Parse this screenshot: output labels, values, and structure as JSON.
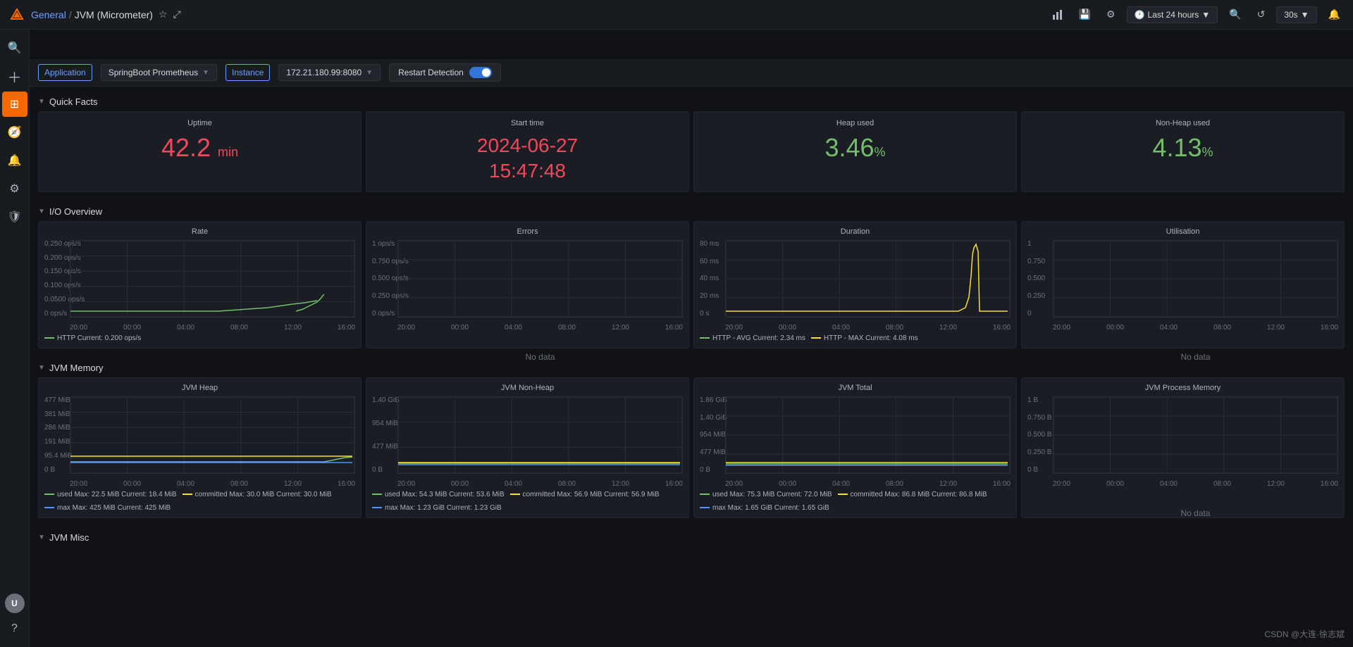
{
  "topbar": {
    "logo": "G",
    "breadcrumb_parent": "General",
    "breadcrumb_separator": "/",
    "breadcrumb_current": "JVM (Micrometer)",
    "time_range": "Last 24 hours",
    "refresh_rate": "30s"
  },
  "toolbar": {
    "application_label": "Application",
    "application_value": "SpringBoot Prometheus",
    "instance_label": "Instance",
    "instance_value": "172.21.180.99:8080",
    "restart_detection_label": "Restart Detection"
  },
  "quick_facts": {
    "section_label": "Quick Facts",
    "uptime_title": "Uptime",
    "uptime_value": "42.2",
    "uptime_unit": "min",
    "start_time_title": "Start time",
    "start_time_line1": "2024-06-27",
    "start_time_line2": "15:47:48",
    "heap_used_title": "Heap used",
    "heap_used_value": "3.46",
    "heap_used_unit": "%",
    "non_heap_used_title": "Non-Heap used",
    "non_heap_used_value": "4.13",
    "non_heap_used_unit": "%"
  },
  "io_overview": {
    "section_label": "I/O Overview",
    "rate_title": "Rate",
    "errors_title": "Errors",
    "duration_title": "Duration",
    "utilisation_title": "Utilisation",
    "rate_y_labels": [
      "0.250 ops/s",
      "0.200 ops/s",
      "0.150 ops/s",
      "0.100 ops/s",
      "0.0500 ops/s",
      "0 ops/s"
    ],
    "errors_y_labels": [
      "1 ops/s",
      "0.750 ops/s",
      "0.500 ops/s",
      "0.250 ops/s",
      "0 ops/s"
    ],
    "duration_y_labels": [
      "80 ms",
      "60 ms",
      "40 ms",
      "20 ms",
      "0 s"
    ],
    "utilisation_y_labels": [
      "1",
      "0.750",
      "0.500",
      "0.250",
      "0"
    ],
    "x_labels": [
      "20:00",
      "00:00",
      "04:00",
      "08:00",
      "12:00",
      "16:00"
    ],
    "rate_legend": "HTTP  Current: 0.200 ops/s",
    "duration_legend_avg": "HTTP - AVG  Current: 2.34 ms",
    "duration_legend_max": "HTTP - MAX  Current: 4.08 ms",
    "no_data": "No data"
  },
  "jvm_memory": {
    "section_label": "JVM Memory",
    "heap_title": "JVM Heap",
    "non_heap_title": "JVM Non-Heap",
    "total_title": "JVM Total",
    "process_title": "JVM Process Memory",
    "heap_y_labels": [
      "477 MiB",
      "381 MiB",
      "286 MiB",
      "191 MiB",
      "95.4 MiB",
      "0 B"
    ],
    "non_heap_y_labels": [
      "1.40 GiB",
      "954 MiB",
      "477 MiB",
      "0 B"
    ],
    "total_y_labels": [
      "1.86 GiB",
      "1.40 GiB",
      "954 MiB",
      "477 MiB",
      "0 B"
    ],
    "process_y_labels": [
      "1 B",
      "0.750 B",
      "0.500 B",
      "0.250 B",
      "0 B"
    ],
    "x_labels": [
      "20:00",
      "00:00",
      "04:00",
      "08:00",
      "12:00",
      "16:00"
    ],
    "heap_legend_used": "used  Max: 22.5 MiB  Current: 18.4 MiB",
    "heap_legend_committed": "committed  Max: 30.0 MiB  Current: 30.0 MiB",
    "heap_legend_max": "max  Max: 425 MiB  Current: 425 MiB",
    "non_heap_legend_used": "used  Max: 54.3 MiB  Current: 53.6 MiB",
    "non_heap_legend_committed": "committed  Max: 56.9 MiB  Current: 56.9 MiB",
    "non_heap_legend_max": "max  Max: 1.23 GiB  Current: 1.23 GiB",
    "total_legend_used": "used  Max: 75.3 MiB  Current: 72.0 MiB",
    "total_legend_committed": "committed  Max: 86.8 MiB  Current: 86.8 MiB",
    "total_legend_max": "max  Max: 1.65 GiB  Current: 1.65 GiB",
    "no_data": "No data"
  },
  "jvm_misc": {
    "section_label": "JVM Misc"
  },
  "sidebar": {
    "icons": [
      "search",
      "plus",
      "grid",
      "compass",
      "bell",
      "gear",
      "shield",
      "question"
    ],
    "active": "grid"
  },
  "watermark": "CSDN @大连·徐志斌"
}
